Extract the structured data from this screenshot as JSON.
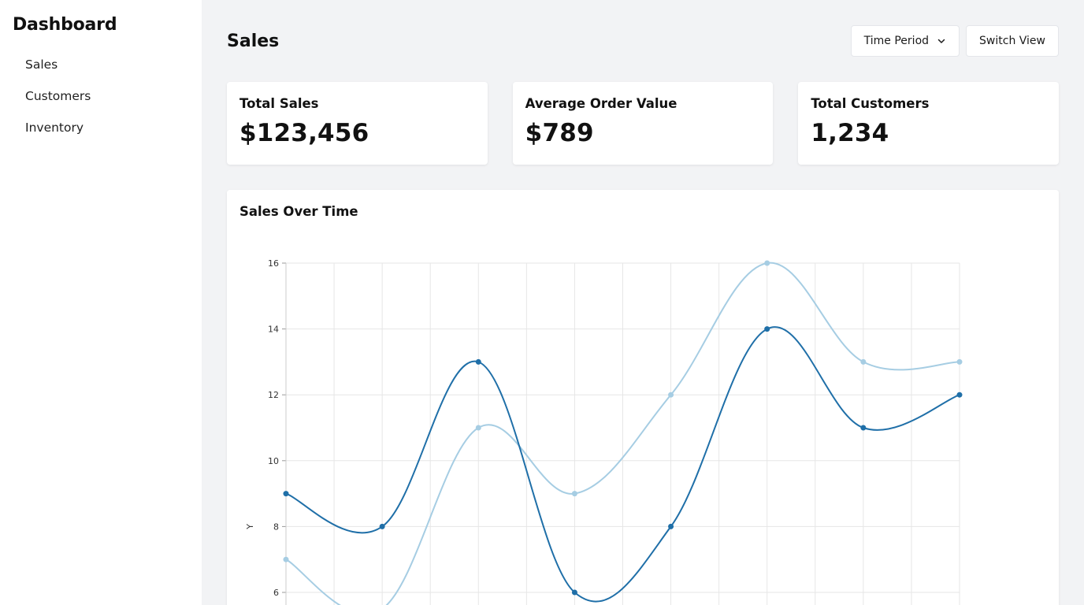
{
  "sidebar": {
    "title": "Dashboard",
    "items": [
      {
        "label": "Sales"
      },
      {
        "label": "Customers"
      },
      {
        "label": "Inventory"
      }
    ]
  },
  "header": {
    "title": "Sales",
    "time_period_label": "Time Period",
    "switch_view_label": "Switch View"
  },
  "cards": [
    {
      "label": "Total Sales",
      "value": "$123,456"
    },
    {
      "label": "Average Order Value",
      "value": "$789"
    },
    {
      "label": "Total Customers",
      "value": "1,234"
    }
  ],
  "chart_card": {
    "title": "Sales Over Time"
  },
  "chart_data": {
    "type": "line",
    "title": "Sales Over Time",
    "xlabel": "",
    "ylabel": "Y",
    "ylim": [
      6,
      16
    ],
    "yticks": [
      6,
      8,
      10,
      12,
      14,
      16
    ],
    "grid": true,
    "x": [
      0,
      1,
      2,
      3,
      4,
      5,
      6,
      7
    ],
    "series": [
      {
        "color": "#1f6fa8",
        "values": [
          9,
          8,
          13,
          6,
          8,
          14,
          11,
          12
        ]
      },
      {
        "color": "#a6cde3",
        "values": [
          7,
          5.5,
          11,
          9,
          12,
          16,
          13,
          13
        ]
      }
    ]
  },
  "colors": {
    "background": "#f2f3f5",
    "card": "#ffffff",
    "grid": "#e6e6e6",
    "series_dark": "#1f6fa8",
    "series_light": "#a6cde3"
  },
  "icons": {
    "time_period_chevron": "chevron-down-icon"
  }
}
